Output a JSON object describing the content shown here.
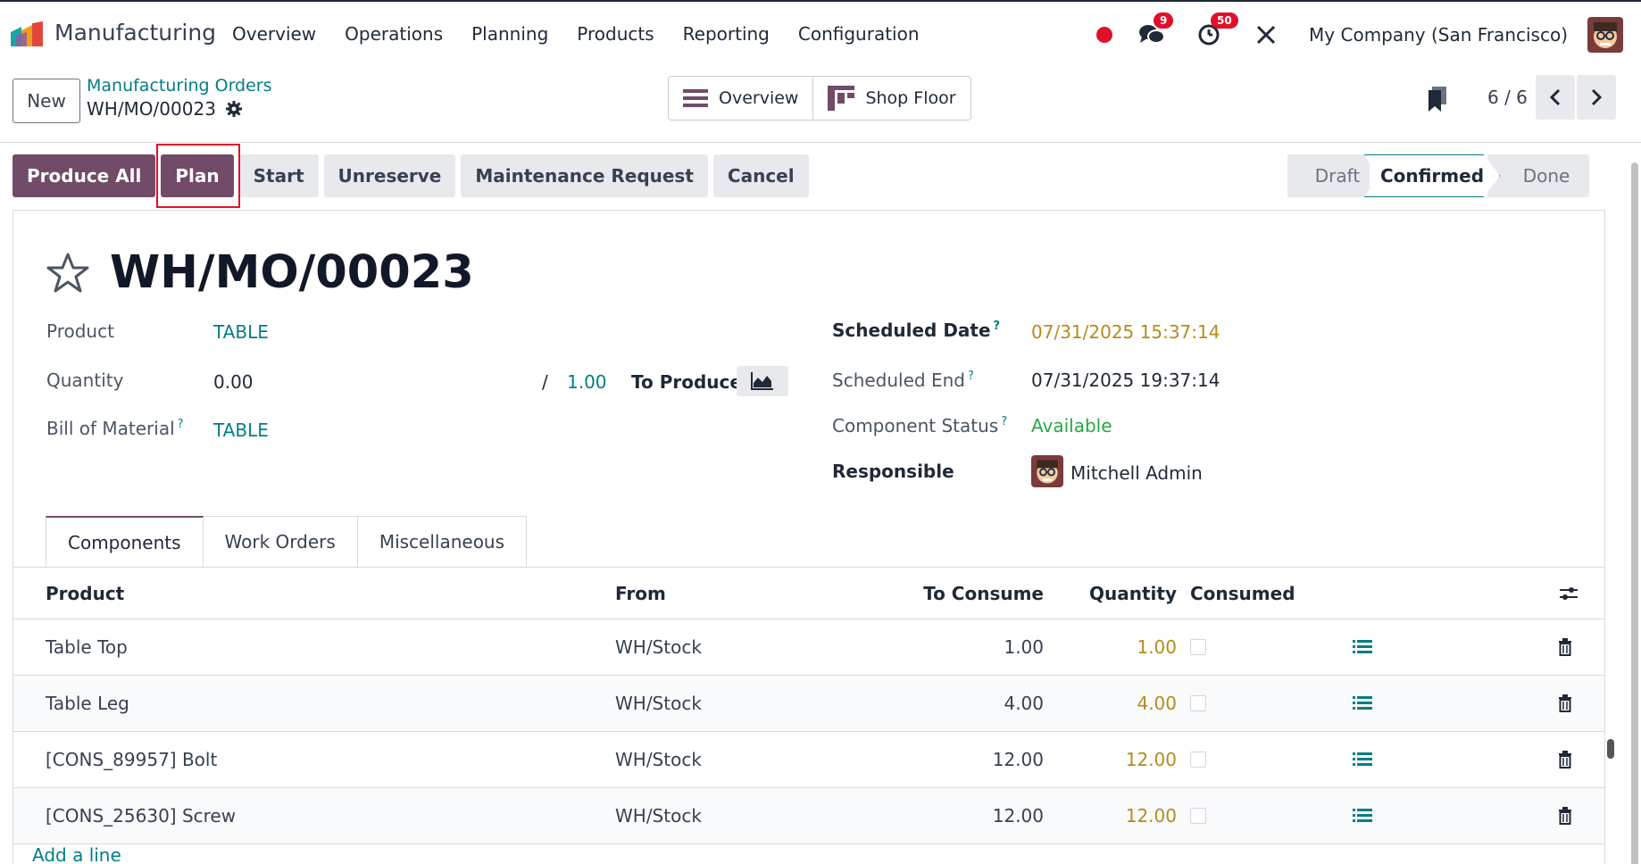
{
  "app": {
    "title": "Manufacturing"
  },
  "menu": [
    "Overview",
    "Operations",
    "Planning",
    "Products",
    "Reporting",
    "Configuration"
  ],
  "systray": {
    "messages_count": "9",
    "activities_count": "50",
    "company": "My Company (San Francisco)"
  },
  "control": {
    "new_label": "New",
    "breadcrumb": "Manufacturing Orders",
    "record": "WH/MO/00023",
    "views": {
      "overview": "Overview",
      "shop_floor": "Shop Floor"
    },
    "pager": "6 / 6"
  },
  "actions": {
    "produce_all": "Produce All",
    "plan": "Plan",
    "start": "Start",
    "unreserve": "Unreserve",
    "maintenance": "Maintenance Request",
    "cancel": "Cancel"
  },
  "stages": {
    "draft": "Draft",
    "confirmed": "Confirmed",
    "done": "Done",
    "current": "Confirmed"
  },
  "form": {
    "title": "WH/MO/00023",
    "product_label": "Product",
    "product_value": "TABLE",
    "quantity_label": "Quantity",
    "quantity_value": "0.00",
    "quantity_sep": "/",
    "quantity_target": "1.00",
    "to_produce": "To Produce",
    "bom_label": "Bill of Material",
    "bom_value": "TABLE",
    "help_mark": "?",
    "scheduled_date_label": "Scheduled Date",
    "scheduled_date_value": "07/31/2025 15:37:14",
    "scheduled_end_label": "Scheduled End",
    "scheduled_end_value": "07/31/2025 19:37:14",
    "component_status_label": "Component Status",
    "component_status_value": "Available",
    "responsible_label": "Responsible",
    "responsible_value": "Mitchell Admin"
  },
  "tabs": [
    "Components",
    "Work Orders",
    "Miscellaneous"
  ],
  "table": {
    "headers": {
      "product": "Product",
      "from": "From",
      "to_consume": "To Consume",
      "quantity": "Quantity",
      "consumed": "Consumed"
    },
    "rows": [
      {
        "product": "Table Top",
        "from": "WH/Stock",
        "to_consume": "1.00",
        "quantity": "1.00"
      },
      {
        "product": "Table Leg",
        "from": "WH/Stock",
        "to_consume": "4.00",
        "quantity": "4.00"
      },
      {
        "product": "[CONS_89957] Bolt",
        "from": "WH/Stock",
        "to_consume": "12.00",
        "quantity": "12.00"
      },
      {
        "product": "[CONS_25630] Screw",
        "from": "WH/Stock",
        "to_consume": "12.00",
        "quantity": "12.00"
      }
    ],
    "add_line": "Add a line"
  },
  "colors": {
    "brand": "#714b67",
    "link": "#017e84",
    "warning": "#b58b1c",
    "success": "#28a745",
    "badge": "#e0102a"
  }
}
